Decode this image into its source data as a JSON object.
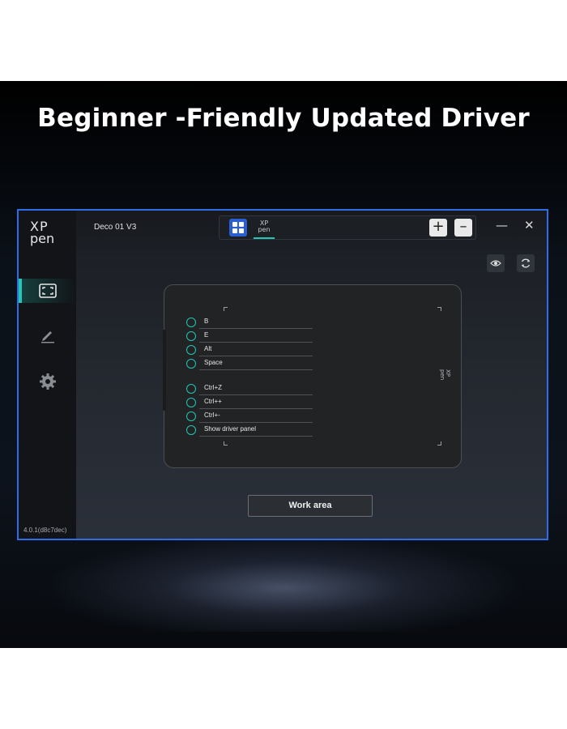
{
  "headline": "Beginner -Friendly Updated Driver",
  "app": {
    "logo_line1": "XP",
    "logo_line2": "pen",
    "version": "4.0.1(d8c7dec)",
    "device_name": "Deco 01 V3",
    "toolbar_tab_line1": "XP",
    "toolbar_tab_line2": "pen",
    "add_label": "+",
    "remove_label": "–",
    "minimize_label": "—",
    "close_label": "✕"
  },
  "sidebar": {
    "items": [
      {
        "name": "work-area",
        "icon": "work-area-icon",
        "active": true
      },
      {
        "name": "pen",
        "icon": "pen-icon",
        "active": false
      },
      {
        "name": "settings",
        "icon": "gear-icon",
        "active": false
      }
    ]
  },
  "tablet": {
    "express_keys": [
      "B",
      "E",
      "Alt",
      "Space",
      "Ctrl+Z",
      "Ctrl++",
      "Ctrl+-",
      "Show driver panel"
    ],
    "logo": "XP pen"
  },
  "work_area_button": "Work area",
  "colors": {
    "accent": "#23c7b5",
    "window_border": "#2f6de8",
    "app_icon": "#2b5fd1"
  }
}
